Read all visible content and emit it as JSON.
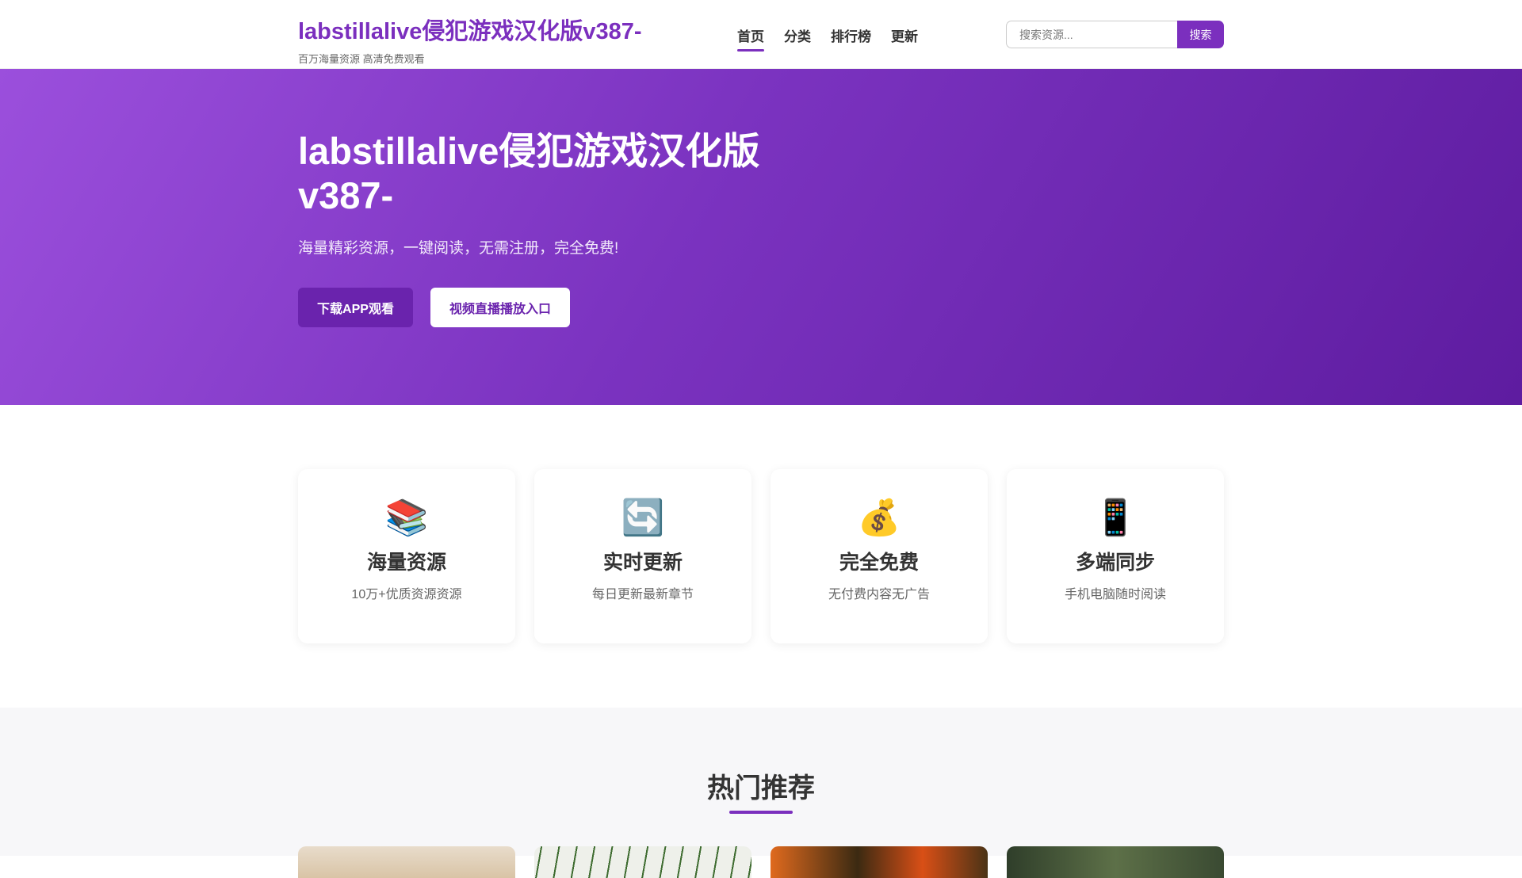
{
  "header": {
    "site_title": "labstillalive侵犯游戏汉化版v387-",
    "site_subtitle": "百万海量资源 高清免费观看",
    "nav": [
      {
        "label": "首页",
        "active": true
      },
      {
        "label": "分类",
        "active": false
      },
      {
        "label": "排行榜",
        "active": false
      },
      {
        "label": "更新",
        "active": false
      }
    ],
    "search": {
      "placeholder": "搜索资源...",
      "button_label": "搜索"
    }
  },
  "hero": {
    "title": "labstillalive侵犯游戏汉化版v387-",
    "subtitle": "海量精彩资源，一键阅读，无需注册，完全免费!",
    "primary_button": "下载APP观看",
    "secondary_button": "视频直播播放入口"
  },
  "features": [
    {
      "icon": "books-icon",
      "glyph": "📚",
      "title": "海量资源",
      "desc": "10万+优质资源资源"
    },
    {
      "icon": "refresh-icon",
      "glyph": "🔄",
      "title": "实时更新",
      "desc": "每日更新最新章节"
    },
    {
      "icon": "money-bag-icon",
      "glyph": "💰",
      "title": "完全免费",
      "desc": "无付费内容无广告"
    },
    {
      "icon": "mobile-phone-icon",
      "glyph": "📱",
      "title": "多端同步",
      "desc": "手机电脑随时阅读"
    }
  ],
  "hot": {
    "title": "热门推荐"
  },
  "colors": {
    "accent": "#7b2fbe",
    "hero_start": "#9b4fdc",
    "hero_end": "#5e1ca0",
    "section_bg": "#f7f7f9"
  }
}
